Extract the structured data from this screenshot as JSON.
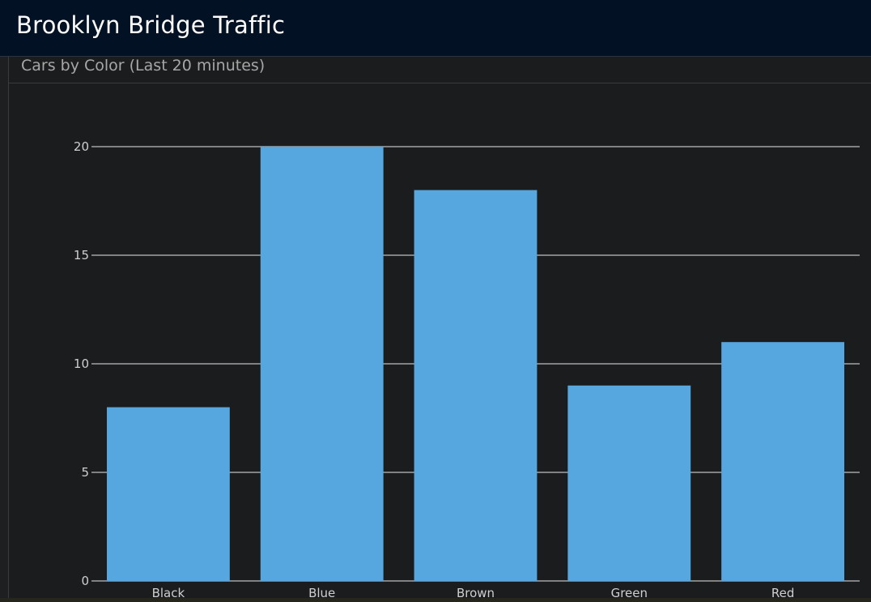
{
  "header": {
    "title": "Brooklyn Bridge Traffic"
  },
  "panel": {
    "title": "Cars by Color (Last 20 minutes)"
  },
  "colors": {
    "bar": "#56a7e0",
    "grid": "#e6e6e6",
    "tick": "#cfcfcf",
    "header_bg": "#021224",
    "page_bg": "#1b1c1e"
  },
  "chart_data": {
    "type": "bar",
    "categories": [
      "Black",
      "Blue",
      "Brown",
      "Green",
      "Red"
    ],
    "values": [
      8,
      20,
      18,
      9,
      11
    ],
    "title": "Cars by Color (Last 20 minutes)",
    "xlabel": "",
    "ylabel": "",
    "ylim": [
      0,
      20
    ],
    "yticks": [
      0,
      5,
      10,
      15,
      20
    ],
    "grid": true,
    "legend": "none"
  }
}
